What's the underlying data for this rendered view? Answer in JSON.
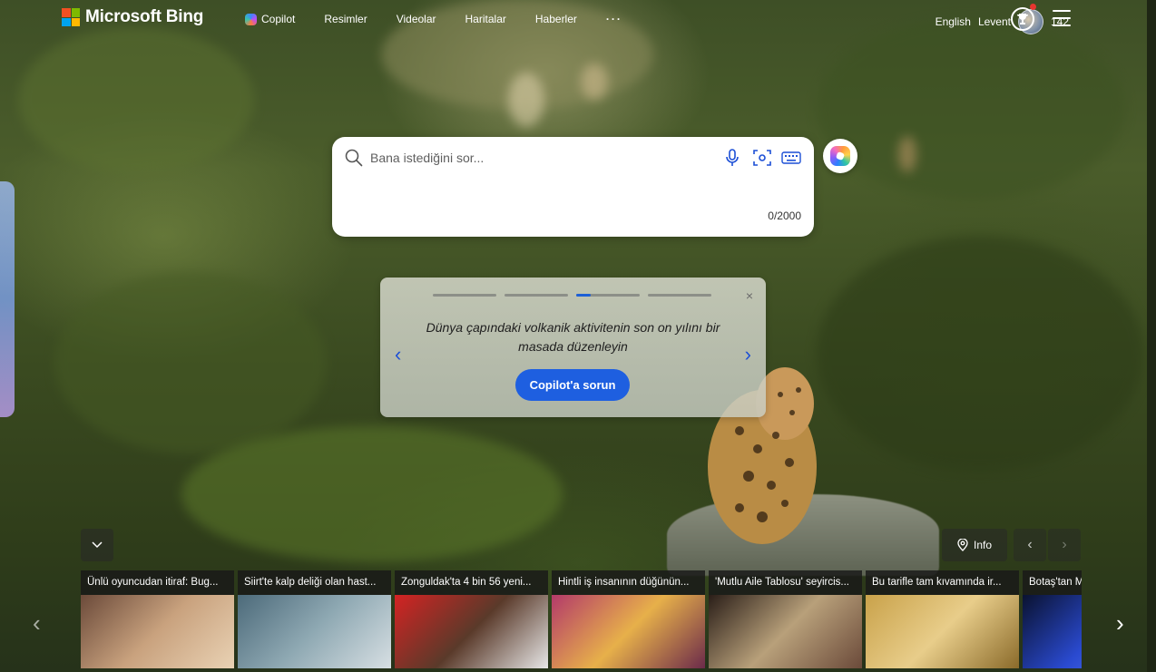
{
  "header": {
    "logo_text": "Microsoft Bing",
    "nav": [
      {
        "label": "Copilot",
        "icon": "copilot-icon"
      },
      {
        "label": "Resimler"
      },
      {
        "label": "Videolar"
      },
      {
        "label": "Haritalar"
      },
      {
        "label": "Haberler"
      }
    ],
    "more_label": "···",
    "language": "English",
    "user_name": "Levent",
    "points": "142",
    "menu_icon": "hamburger-icon"
  },
  "search": {
    "placeholder": "Bana istediğini sor...",
    "counter": "0/2000",
    "tools": [
      "microphone-icon",
      "visual-search-icon",
      "keyboard-icon"
    ]
  },
  "card": {
    "text": "Dünya çapındaki volkanik aktivitenin son on yılını bir masada düzenleyin",
    "cta": "Copilot'a sorun",
    "close": "×",
    "prev": "‹",
    "next": "›",
    "steps": 4,
    "active_step": 3
  },
  "controls": {
    "collapse": "⌄",
    "info": "Info",
    "prev": "‹",
    "next": "›"
  },
  "news": [
    {
      "title": "Ünlü oyuncudan itiraf: Bug...",
      "colors": [
        "#6b4a3a",
        "#c9a27e",
        "#e9d2b4"
      ]
    },
    {
      "title": "Siirt'te kalp deliği olan hast...",
      "colors": [
        "#4c6a7a",
        "#8fa9b3",
        "#d7dfe3"
      ]
    },
    {
      "title": "Zonguldak'ta 4 bin 56 yeni...",
      "colors": [
        "#d42323",
        "#5a3a2a",
        "#e7e7e7"
      ]
    },
    {
      "title": "Hintli iş insanının düğünün...",
      "colors": [
        "#b33a6a",
        "#e7b04a",
        "#6b2a4a"
      ]
    },
    {
      "title": "'Mutlu Aile Tablosu' seyircis...",
      "colors": [
        "#2a1e18",
        "#b8a07a",
        "#6b4a3a"
      ]
    },
    {
      "title": "Bu tarifle tam kıvamında ir...",
      "colors": [
        "#c9a24a",
        "#e8cd8a",
        "#8a6a2a"
      ]
    },
    {
      "title": "Botaş'tan M",
      "colors": [
        "#0a1230",
        "#2a4ad0",
        "#6a8aff"
      ]
    }
  ],
  "strip": {
    "prev": "‹",
    "next": "›"
  }
}
